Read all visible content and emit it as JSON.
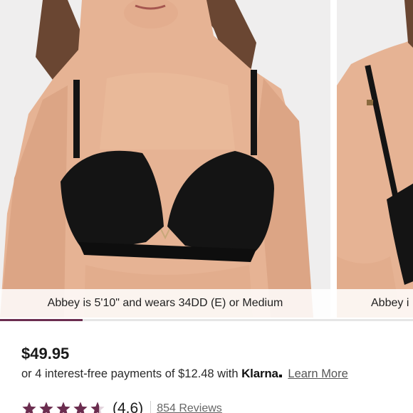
{
  "gallery": {
    "slides": [
      {
        "caption": "Abbey is 5'10\" and wears 34DD (E) or Medium"
      },
      {
        "caption": "Abbey i"
      }
    ],
    "progress": 0.2
  },
  "product": {
    "price": "$49.95",
    "installments_text": "or 4 interest-free payments of $12.48 with",
    "klarna_logo": "Klarna",
    "learn_more": "Learn More"
  },
  "rating": {
    "stars": 4.6,
    "value": "(4.6)",
    "reviews": "854 Reviews"
  },
  "colors": {
    "accent": "#6b2d4f",
    "star": "#6b2d4f",
    "text": "#1a1a1a",
    "muted": "#666666"
  },
  "icons": {
    "star": "star-icon"
  }
}
